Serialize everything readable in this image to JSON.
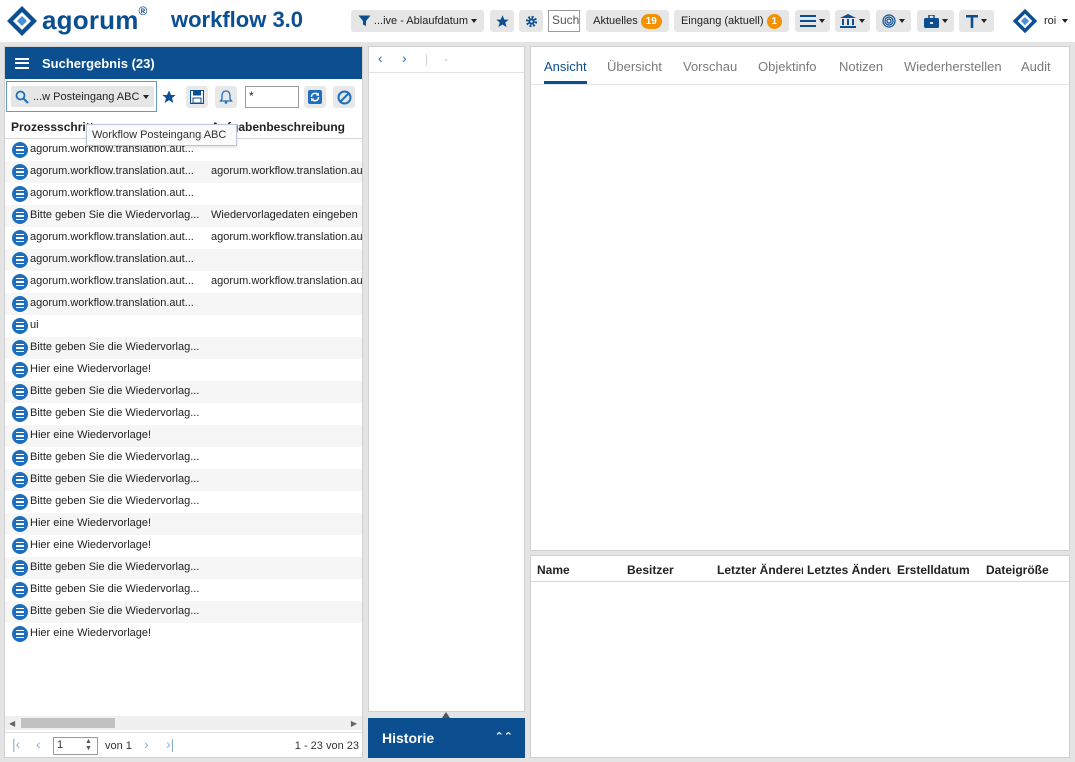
{
  "header": {
    "brand": "agorum",
    "brand_mark": "®",
    "app_title": "workflow 3.0",
    "filter_label": "...ive - Ablaufdatum",
    "search_placeholder": "Suche",
    "aktuelles_label": "Aktuelles",
    "aktuelles_count": "19",
    "eingang_label": "Eingang (aktuell)",
    "eingang_count": "1",
    "user_name": "roi"
  },
  "search_panel": {
    "title": "Suchergebnis (23)",
    "search_selector": "...w Posteingang ABC",
    "filter_value": "*",
    "tooltip": "Workflow Posteingang ABC",
    "columns": [
      "Prozessschritt",
      "Aufgabenbeschreibung"
    ],
    "rows": [
      {
        "step": "agorum.workflow.translation.aut...",
        "desc": ""
      },
      {
        "step": "agorum.workflow.translation.aut...",
        "desc": "agorum.workflow.translation.au"
      },
      {
        "step": "agorum.workflow.translation.aut...",
        "desc": ""
      },
      {
        "step": "Bitte geben Sie die Wiedervorlag...",
        "desc": "Wiedervorlagedaten eingeben"
      },
      {
        "step": "agorum.workflow.translation.aut...",
        "desc": "agorum.workflow.translation.au"
      },
      {
        "step": "agorum.workflow.translation.aut...",
        "desc": ""
      },
      {
        "step": "agorum.workflow.translation.aut...",
        "desc": "agorum.workflow.translation.au"
      },
      {
        "step": "agorum.workflow.translation.aut...",
        "desc": ""
      },
      {
        "step": "ui",
        "desc": ""
      },
      {
        "step": "Bitte geben Sie die Wiedervorlag...",
        "desc": ""
      },
      {
        "step": "Hier eine Wiedervorlage!",
        "desc": ""
      },
      {
        "step": "Bitte geben Sie die Wiedervorlag...",
        "desc": ""
      },
      {
        "step": "Bitte geben Sie die Wiedervorlag...",
        "desc": ""
      },
      {
        "step": "Hier eine Wiedervorlage!",
        "desc": ""
      },
      {
        "step": "Bitte geben Sie die Wiedervorlag...",
        "desc": ""
      },
      {
        "step": "Bitte geben Sie die Wiedervorlag...",
        "desc": ""
      },
      {
        "step": "Bitte geben Sie die Wiedervorlag...",
        "desc": ""
      },
      {
        "step": "Hier eine Wiedervorlage!",
        "desc": ""
      },
      {
        "step": "Hier eine Wiedervorlage!",
        "desc": ""
      },
      {
        "step": "Bitte geben Sie die Wiedervorlag...",
        "desc": ""
      },
      {
        "step": "Bitte geben Sie die Wiedervorlag...",
        "desc": ""
      },
      {
        "step": "Bitte geben Sie die Wiedervorlag...",
        "desc": ""
      },
      {
        "step": "Hier eine Wiedervorlage!",
        "desc": ""
      }
    ],
    "pager": {
      "page": "1",
      "of_label": "von 1",
      "range": "1 - 23 von 23"
    }
  },
  "middle": {
    "nav_separator": "|",
    "nav_dash": "-",
    "history_label": "Historie"
  },
  "detail": {
    "tabs": [
      "Ansicht",
      "Übersicht",
      "Vorschau",
      "Objektinfo",
      "Notizen",
      "Wiederherstellen",
      "Audit"
    ],
    "active_tab": "Ansicht",
    "file_columns": [
      "Name",
      "Besitzer",
      "Letzter Änderer",
      "Letztes Änderungsdatum",
      "Erstelldatum",
      "Dateigröße"
    ]
  },
  "colors": {
    "brand_blue": "#0b4f91",
    "icon_blue": "#1d6fbe",
    "badge_orange": "#f39200"
  }
}
